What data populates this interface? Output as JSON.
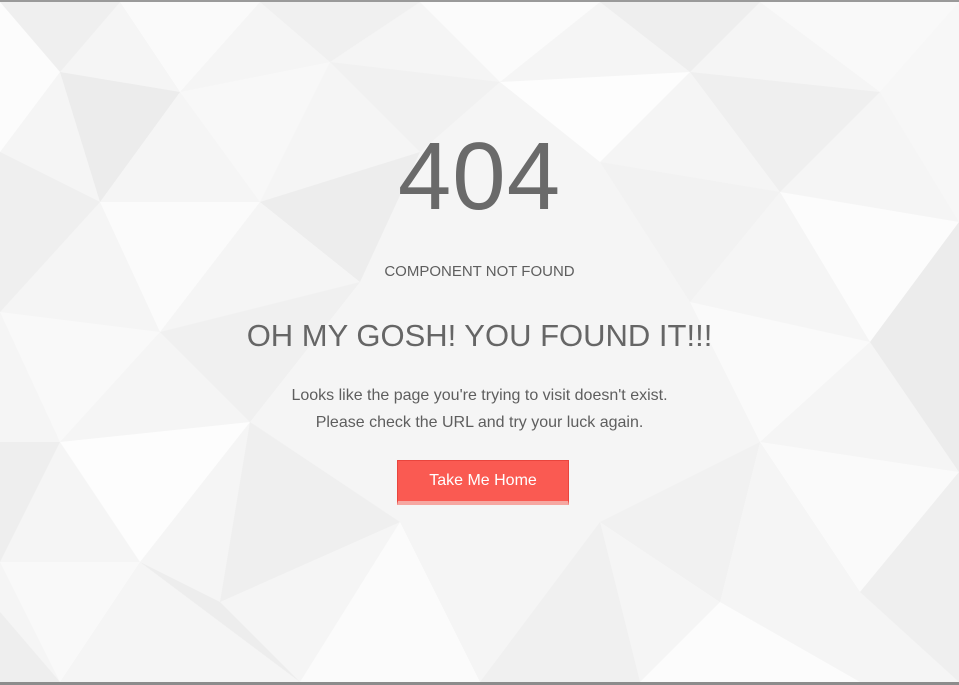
{
  "error": {
    "code": "404",
    "subtitle": "COMPONENT NOT FOUND",
    "headline": "OH MY GOSH! YOU FOUND IT!!!",
    "message_line1": "Looks like the page you're trying to visit doesn't exist.",
    "message_line2": "Please check the URL and try your luck again."
  },
  "actions": {
    "home_label": "Take Me Home"
  },
  "colors": {
    "accent": "#fa5a52",
    "text": "#666666",
    "background": "#f4f4f4"
  }
}
